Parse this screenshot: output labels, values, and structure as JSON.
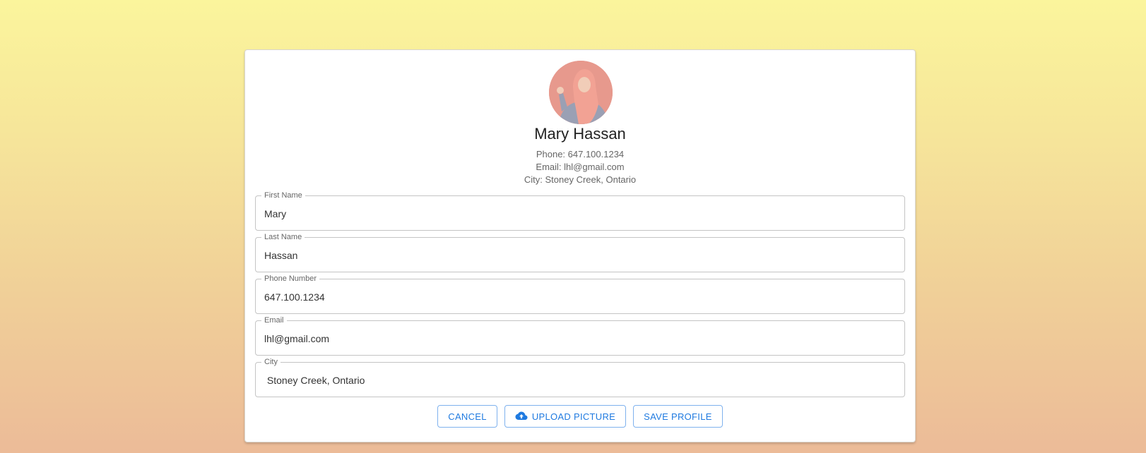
{
  "profile": {
    "name": "Mary Hassan",
    "phone_line": "Phone: 647.100.1234",
    "email_line": "Email: lhl@gmail.com",
    "city_line": "City: Stoney Creek, Ontario"
  },
  "form": {
    "first_name": {
      "label": "First Name",
      "value": "Mary"
    },
    "last_name": {
      "label": "Last Name",
      "value": "Hassan"
    },
    "phone": {
      "label": "Phone Number",
      "value": "647.100.1234"
    },
    "email": {
      "label": "Email",
      "value": "lhl@gmail.com"
    },
    "city": {
      "label": "City",
      "value": " Stoney Creek, Ontario"
    }
  },
  "actions": {
    "cancel_label": "CANCEL",
    "upload_label": "UPLOAD PICTURE",
    "save_label": "SAVE PROFILE"
  },
  "colors": {
    "accent": "#1f7ae0",
    "button_border": "#7fb2ee",
    "field_border": "#c4c4c4",
    "background_top": "#fbf59c",
    "background_bottom": "#ecbb98"
  },
  "icons": {
    "upload": "cloud-upload-icon"
  }
}
